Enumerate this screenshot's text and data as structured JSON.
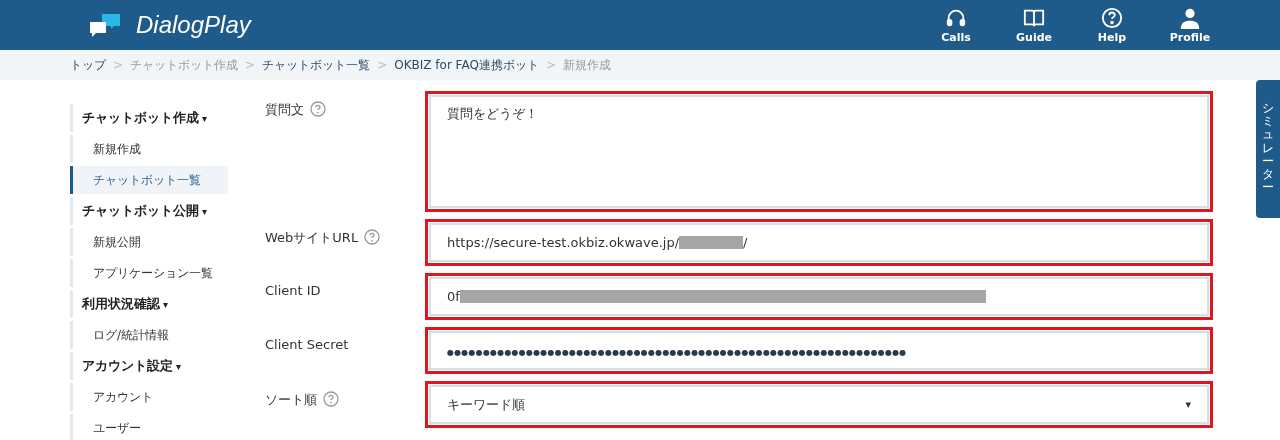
{
  "header": {
    "logo": "DialogPlay",
    "nav": [
      {
        "kind": "headset",
        "label": "Calls"
      },
      {
        "kind": "book",
        "label": "Guide"
      },
      {
        "kind": "help",
        "label": "Help"
      },
      {
        "kind": "profile",
        "label": "Profile"
      }
    ]
  },
  "breadcrumb_separator": ">",
  "menu_caret": "▾",
  "breadcrumb": [
    {
      "label": "トップ",
      "link": true
    },
    {
      "label": "チャットボット作成",
      "link": false
    },
    {
      "label": "チャットボット一覧",
      "link": true
    },
    {
      "label": "OKBIZ for FAQ連携ボット",
      "link": true
    },
    {
      "label": "新規作成",
      "link": false
    }
  ],
  "sidebar": [
    {
      "heading": "チャットボット作成",
      "items": [
        {
          "label": "新規作成",
          "selected": false
        },
        {
          "label": "チャットボット一覧",
          "selected": true
        }
      ]
    },
    {
      "heading": "チャットボット公開",
      "items": [
        {
          "label": "新規公開",
          "selected": false
        },
        {
          "label": "アプリケーション一覧",
          "selected": false
        }
      ]
    },
    {
      "heading": "利用状況確認",
      "items": [
        {
          "label": "ログ/統計情報",
          "selected": false
        }
      ]
    },
    {
      "heading": "アカウント設定",
      "items": [
        {
          "label": "アカウント",
          "selected": false
        },
        {
          "label": "ユーザー",
          "selected": false
        }
      ]
    }
  ],
  "form": [
    {
      "kind": "textarea",
      "label": "質問文",
      "help": true,
      "value": "質問をどうぞ！",
      "highlighted": true
    },
    {
      "kind": "text",
      "label": "WebサイトURL",
      "help": true,
      "value": "https://secure-test.okbiz.okwave.jp/",
      "redaction": {
        "kind": "short"
      },
      "suffix": "/",
      "highlighted": true
    },
    {
      "kind": "text",
      "label": "Client ID",
      "help": false,
      "value": "0f",
      "redaction": {
        "kind": "long"
      },
      "highlighted": true
    },
    {
      "kind": "password",
      "label": "Client Secret",
      "help": false,
      "value": "●●●●●●●●●●●●●●●●●●●●●●●●●●●●●●●●●●●●●●●●●●●●●●●●●●●●●●●●●●●●●●●●",
      "highlighted": true
    },
    {
      "kind": "select",
      "label": "ソート順",
      "help": true,
      "value": "キーワード順",
      "caret": "▾",
      "highlighted": true
    }
  ],
  "simulator_tab": "シミュレーター"
}
